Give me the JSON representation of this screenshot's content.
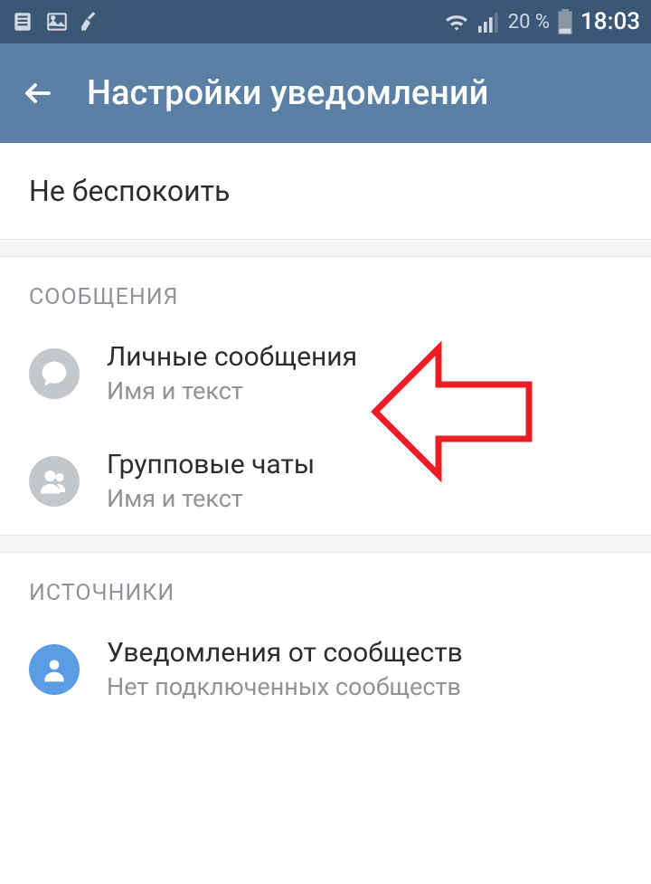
{
  "status_bar": {
    "battery_percent": "20 %",
    "time": "18:03"
  },
  "app_bar": {
    "title": "Настройки уведомлений"
  },
  "do_not_disturb": {
    "label": "Не беспокоить"
  },
  "sections": {
    "messages": {
      "header": "СООБЩЕНИЯ",
      "items": [
        {
          "title": "Личные сообщения",
          "subtitle": "Имя и текст"
        },
        {
          "title": "Групповые чаты",
          "subtitle": "Имя и текст"
        }
      ]
    },
    "sources": {
      "header": "ИСТОЧНИКИ",
      "items": [
        {
          "title": "Уведомления от сообществ",
          "subtitle": "Нет подключенных сообществ"
        }
      ]
    }
  }
}
